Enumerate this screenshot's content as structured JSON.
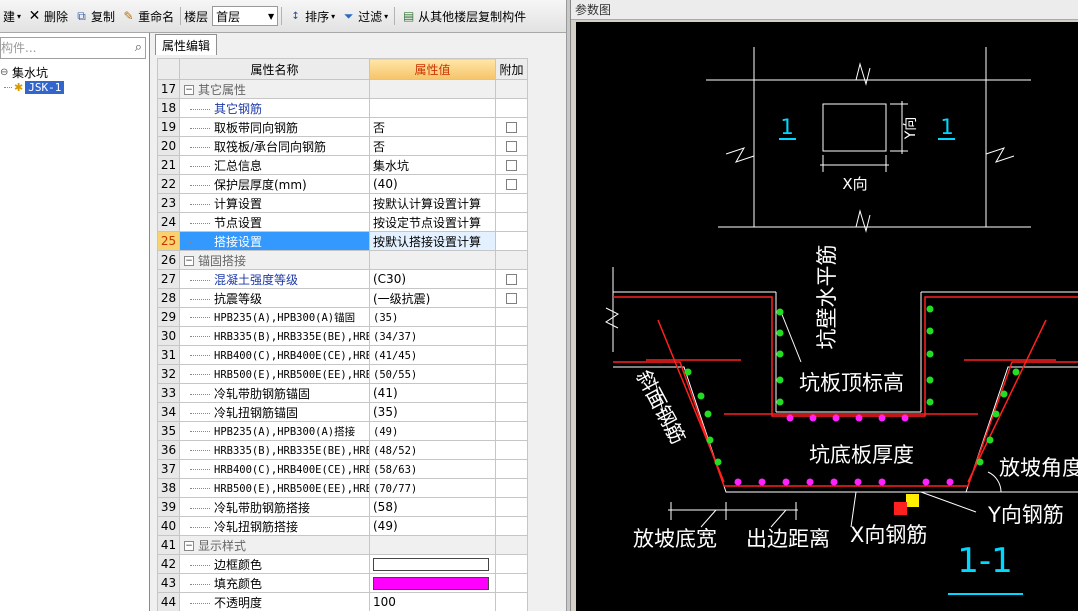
{
  "toolbar": {
    "new_label": "建",
    "delete_label": "删除",
    "copy_label": "复制",
    "rename_label": "重命名",
    "floor_label": "楼层",
    "floor_value": "首层",
    "sort_label": "排序",
    "filter_label": "过滤",
    "copy_from_floor_label": "从其他楼层复制构件"
  },
  "left_panel": {
    "search_placeholder": "构件...",
    "tree": {
      "root_label": "集水坑",
      "child_label": "JSK-1"
    }
  },
  "property_panel": {
    "tab_label": "属性编辑",
    "headers": {
      "name": "属性名称",
      "value": "属性值",
      "extra": "附加"
    },
    "rows": [
      {
        "num": "17",
        "name": "其它属性",
        "value": "",
        "kind": "group"
      },
      {
        "num": "18",
        "name": "其它钢筋",
        "value": "",
        "kind": "blue"
      },
      {
        "num": "19",
        "name": "取板带同向钢筋",
        "value": "否",
        "checkbox": true
      },
      {
        "num": "20",
        "name": "取筏板/承台同向钢筋",
        "value": "否",
        "checkbox": true
      },
      {
        "num": "21",
        "name": "汇总信息",
        "value": "集水坑",
        "checkbox": true
      },
      {
        "num": "22",
        "name": "保护层厚度(mm)",
        "value": "(40)",
        "checkbox": true
      },
      {
        "num": "23",
        "name": "计算设置",
        "value": "按默认计算设置计算"
      },
      {
        "num": "24",
        "name": "节点设置",
        "value": "按设定节点设置计算"
      },
      {
        "num": "25",
        "name": "搭接设置",
        "value": "按默认搭接设置计算",
        "kind": "selected"
      },
      {
        "num": "26",
        "name": "锚固搭接",
        "value": "",
        "kind": "group"
      },
      {
        "num": "27",
        "name": "混凝土强度等级",
        "value": "(C30)",
        "kind": "blue",
        "checkbox": true
      },
      {
        "num": "28",
        "name": "抗震等级",
        "value": "(一级抗震)",
        "checkbox": true
      },
      {
        "num": "29",
        "name": "HPB235(A),HPB300(A)锚固",
        "value": "(35)",
        "kind": "small"
      },
      {
        "num": "30",
        "name": "HRB335(B),HRB335E(BE),HRBF",
        "value": "(34/37)",
        "kind": "small"
      },
      {
        "num": "31",
        "name": "HRB400(C),HRB400E(CE),HRBF",
        "value": "(41/45)",
        "kind": "small"
      },
      {
        "num": "32",
        "name": "HRB500(E),HRB500E(EE),HRBF",
        "value": "(50/55)",
        "kind": "small"
      },
      {
        "num": "33",
        "name": "冷轧带肋钢筋锚固",
        "value": "(41)"
      },
      {
        "num": "34",
        "name": "冷轧扭钢筋锚固",
        "value": "(35)"
      },
      {
        "num": "35",
        "name": "HPB235(A),HPB300(A)搭接",
        "value": "(49)",
        "kind": "small"
      },
      {
        "num": "36",
        "name": "HRB335(B),HRB335E(BE),HRBF",
        "value": "(48/52)",
        "kind": "small"
      },
      {
        "num": "37",
        "name": "HRB400(C),HRB400E(CE),HRBF",
        "value": "(58/63)",
        "kind": "small"
      },
      {
        "num": "38",
        "name": "HRB500(E),HRB500E(EE),HRBF",
        "value": "(70/77)",
        "kind": "small"
      },
      {
        "num": "39",
        "name": "冷轧带肋钢筋搭接",
        "value": "(58)"
      },
      {
        "num": "40",
        "name": "冷轧扭钢筋搭接",
        "value": "(49)"
      },
      {
        "num": "41",
        "name": "显示样式",
        "value": "",
        "kind": "group"
      },
      {
        "num": "42",
        "name": "边框颜色",
        "value": "",
        "swatch": "#ffffff"
      },
      {
        "num": "43",
        "name": "填充颜色",
        "value": "",
        "swatch": "#ff00ff"
      },
      {
        "num": "44",
        "name": "不透明度",
        "value": "100"
      }
    ]
  },
  "reference_panel": {
    "title": "参数图",
    "plan_labels": {
      "section_left": "1",
      "section_right": "1",
      "x_dir": "X向",
      "y_dir": "Y向"
    },
    "section_labels": {
      "wall_horizontal_rebar": "坑壁水平筋",
      "pit_slab_top_elev": "坑板顶标高",
      "slope_rebar": "斜面钢筋",
      "pit_slab_thickness": "坑底板厚度",
      "slope_angle": "放坡角度",
      "slope_bottom_width": "放坡底宽",
      "edge_distance": "出边距离",
      "x_rebar": "X向钢筋",
      "y_rebar": "Y向钢筋",
      "section_title": "1-1"
    },
    "colors": {
      "background": "#000000",
      "rebar_red": "#ff2020",
      "rebar_dot_green": "#22dd22",
      "rebar_dot_magenta": "#ff22ff",
      "label_white": "#ffffff",
      "section_cyan": "#00d8ff"
    }
  }
}
